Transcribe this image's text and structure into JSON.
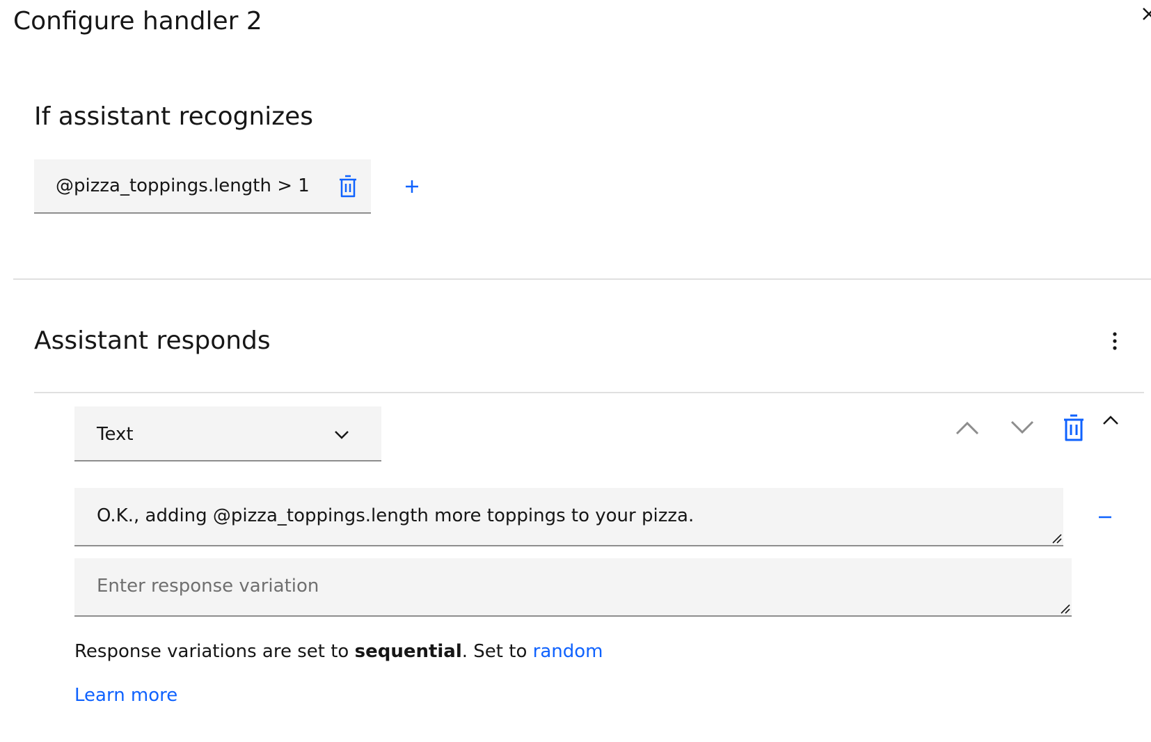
{
  "panel": {
    "title": "Configure handler 2",
    "close_icon": "close-icon"
  },
  "recognizes": {
    "heading": "If assistant recognizes",
    "condition": "@pizza_toppings.length > 1",
    "delete_icon": "trash-icon",
    "add_icon": "add-icon"
  },
  "responds": {
    "heading": "Assistant responds",
    "overflow_icon": "overflow-menu-vertical-icon",
    "response_type": {
      "selected": "Text",
      "chevron_icon": "chevron-down-icon"
    },
    "controls": {
      "move_up_icon": "chevron-up-icon",
      "move_down_icon": "chevron-down-icon",
      "delete_icon": "trash-icon",
      "collapse_icon": "chevron-up-icon"
    },
    "variations": [
      {
        "value": "O.K., adding @pizza_toppings.length more toppings to your pizza."
      }
    ],
    "new_variation_placeholder": "Enter response variation",
    "remove_icon": "subtract-icon",
    "note": {
      "prefix": "Response variations are set to ",
      "mode": "sequential",
      "middle": ". Set to ",
      "link": "random"
    },
    "learn_more": "Learn more"
  },
  "colors": {
    "link": "#0f62fe",
    "field_bg": "#f4f4f4",
    "field_border": "#8d8d8d",
    "divider": "#e0e0e0",
    "text": "#161616",
    "placeholder": "#6f6f6f",
    "icon_gray": "#8d8d8d"
  }
}
